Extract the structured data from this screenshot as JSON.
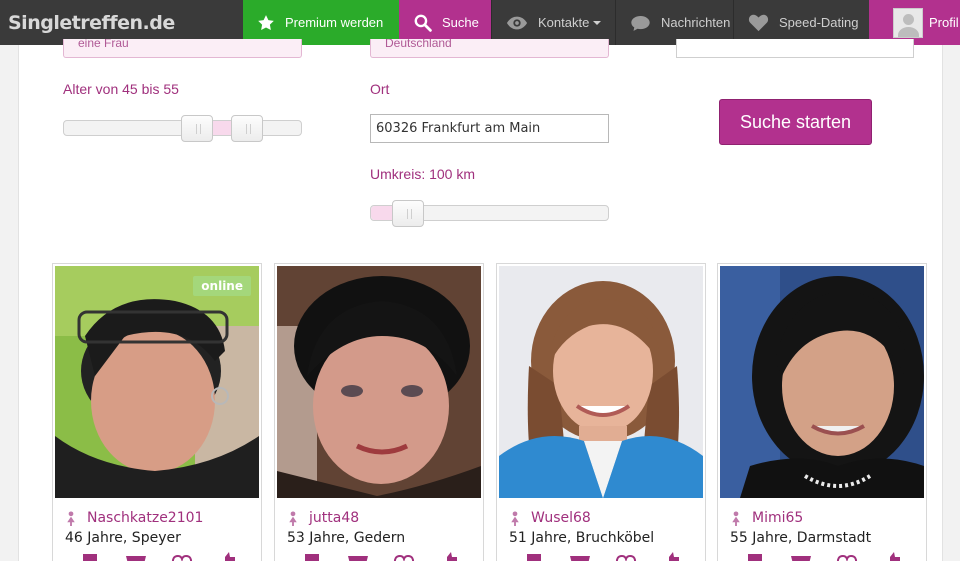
{
  "nav": {
    "logo": "Singletreffen.de",
    "premium_label": "Premium werden",
    "suche_label": "Suche",
    "kontakte_label": "Kontakte",
    "nachrichten_label": "Nachrichten",
    "speed_label": "Speed-Dating",
    "profil_label": "Profil"
  },
  "search": {
    "gender_value": "eine Frau",
    "country_value": "Deutschland",
    "age_label": "Alter von 45 bis 55",
    "age_min": 45,
    "age_max": 55,
    "ort_label": "Ort",
    "ort_value": "60326 Frankfurt am Main",
    "umkreis_label": "Umkreis: 100 km",
    "umkreis_km": 100,
    "submit_label": "Suche starten"
  },
  "profiles": [
    {
      "name": "Naschkatze2101",
      "info": "46 Jahre, Speyer",
      "online": true,
      "online_label": "online"
    },
    {
      "name": "jutta48",
      "info": "53 Jahre, Gedern",
      "online": false
    },
    {
      "name": "Wusel68",
      "info": "51 Jahre, Bruchköbel",
      "online": false
    },
    {
      "name": "Mimi65",
      "info": "55 Jahre, Darmstadt",
      "online": false
    }
  ],
  "colors": {
    "accent": "#b2318e",
    "premium": "#2bab2a",
    "nav_bg": "#3a3a3a",
    "online_badge": "#a4d77b"
  },
  "icons": [
    "star-icon",
    "search-icon",
    "eye-icon",
    "chat-bubble-icon",
    "heart-icon",
    "female-icon",
    "gift-icon",
    "thumbs-up-icon"
  ]
}
